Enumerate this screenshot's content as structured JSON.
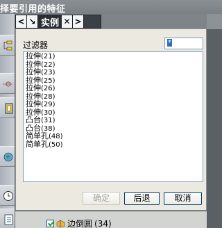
{
  "background": {
    "title": "择要引用的特征"
  },
  "tabbar": {
    "left_arrow": "<",
    "pick_glyph": "↘",
    "label": "实例",
    "close": "✕",
    "right_arrow": ">"
  },
  "dialog": {
    "filter_label": "过滤器",
    "filter_value": "*",
    "items": [
      {
        "name": "拉伸",
        "num": "(21)"
      },
      {
        "name": "拉伸",
        "num": "(22)"
      },
      {
        "name": "拉伸",
        "num": "(23)"
      },
      {
        "name": "拉伸",
        "num": "(25)"
      },
      {
        "name": "拉伸",
        "num": "(26)"
      },
      {
        "name": "拉伸",
        "num": "(28)"
      },
      {
        "name": "拉伸",
        "num": "(29)"
      },
      {
        "name": "拉伸",
        "num": "(30)"
      },
      {
        "name": "凸台",
        "num": "(31)"
      },
      {
        "name": "凸台",
        "num": "(38)"
      },
      {
        "name": "简单孔",
        "num": "(48)"
      },
      {
        "name": "简单孔",
        "num": "(50)"
      }
    ],
    "buttons": {
      "ok": "确定",
      "back": "后退",
      "cancel": "取消"
    }
  },
  "tree": {
    "row_label": "边倒圆",
    "row_num": "(34)"
  },
  "colors": {
    "accent_border": "#003c74",
    "input_border": "#7f9db9",
    "check_green": "#21a121"
  }
}
